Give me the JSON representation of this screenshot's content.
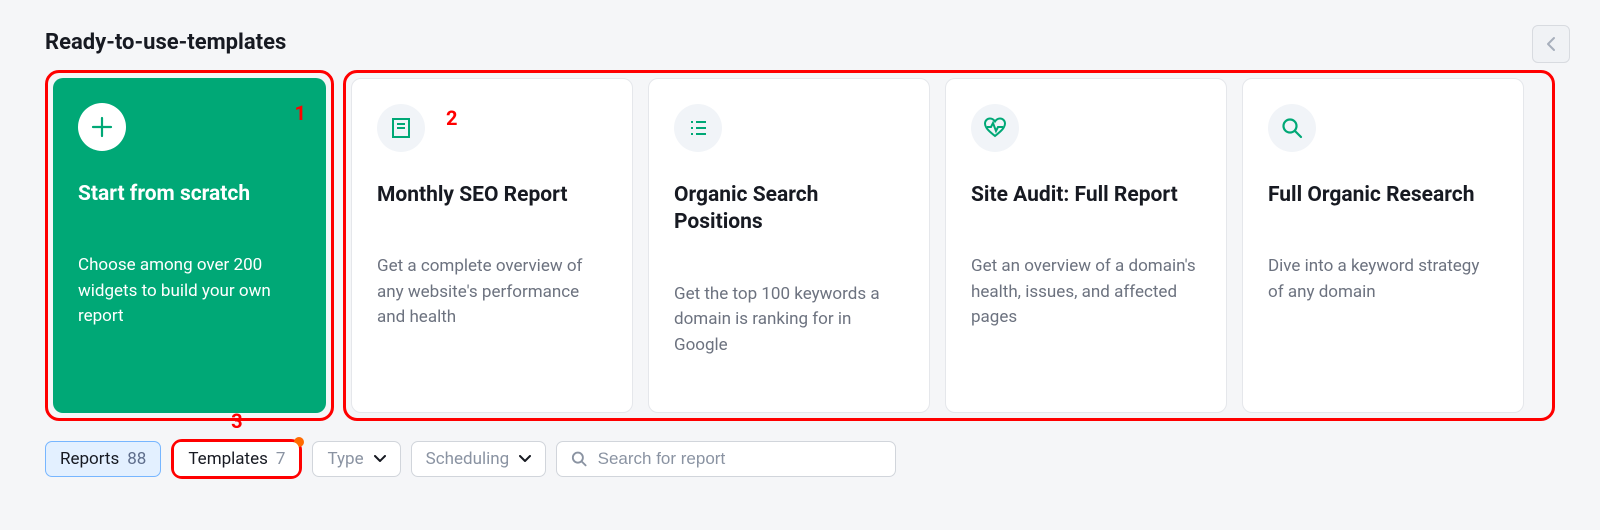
{
  "section_title": "Ready-to-use-templates",
  "annotations": {
    "a1": "1",
    "a2": "2",
    "a3": "3"
  },
  "cards": {
    "scratch": {
      "title": "Start from scratch",
      "desc": "Choose among over 200 widgets to build your own report"
    },
    "templates": [
      {
        "title": "Monthly SEO Report",
        "desc": "Get a complete overview of any website's performance and health"
      },
      {
        "title": "Organic Search Positions",
        "desc": "Get the top 100 keywords a domain is ranking for in Google"
      },
      {
        "title": "Site Audit: Full Report",
        "desc": "Get an overview of a domain's health, issues, and affected pages"
      },
      {
        "title": "Full Organic Research",
        "desc": "Dive into a keyword strategy of any domain"
      }
    ]
  },
  "filters": {
    "reports_label": "Reports",
    "reports_count": "88",
    "templates_label": "Templates",
    "templates_count": "7",
    "type_label": "Type",
    "scheduling_label": "Scheduling",
    "search_placeholder": "Search for report"
  }
}
